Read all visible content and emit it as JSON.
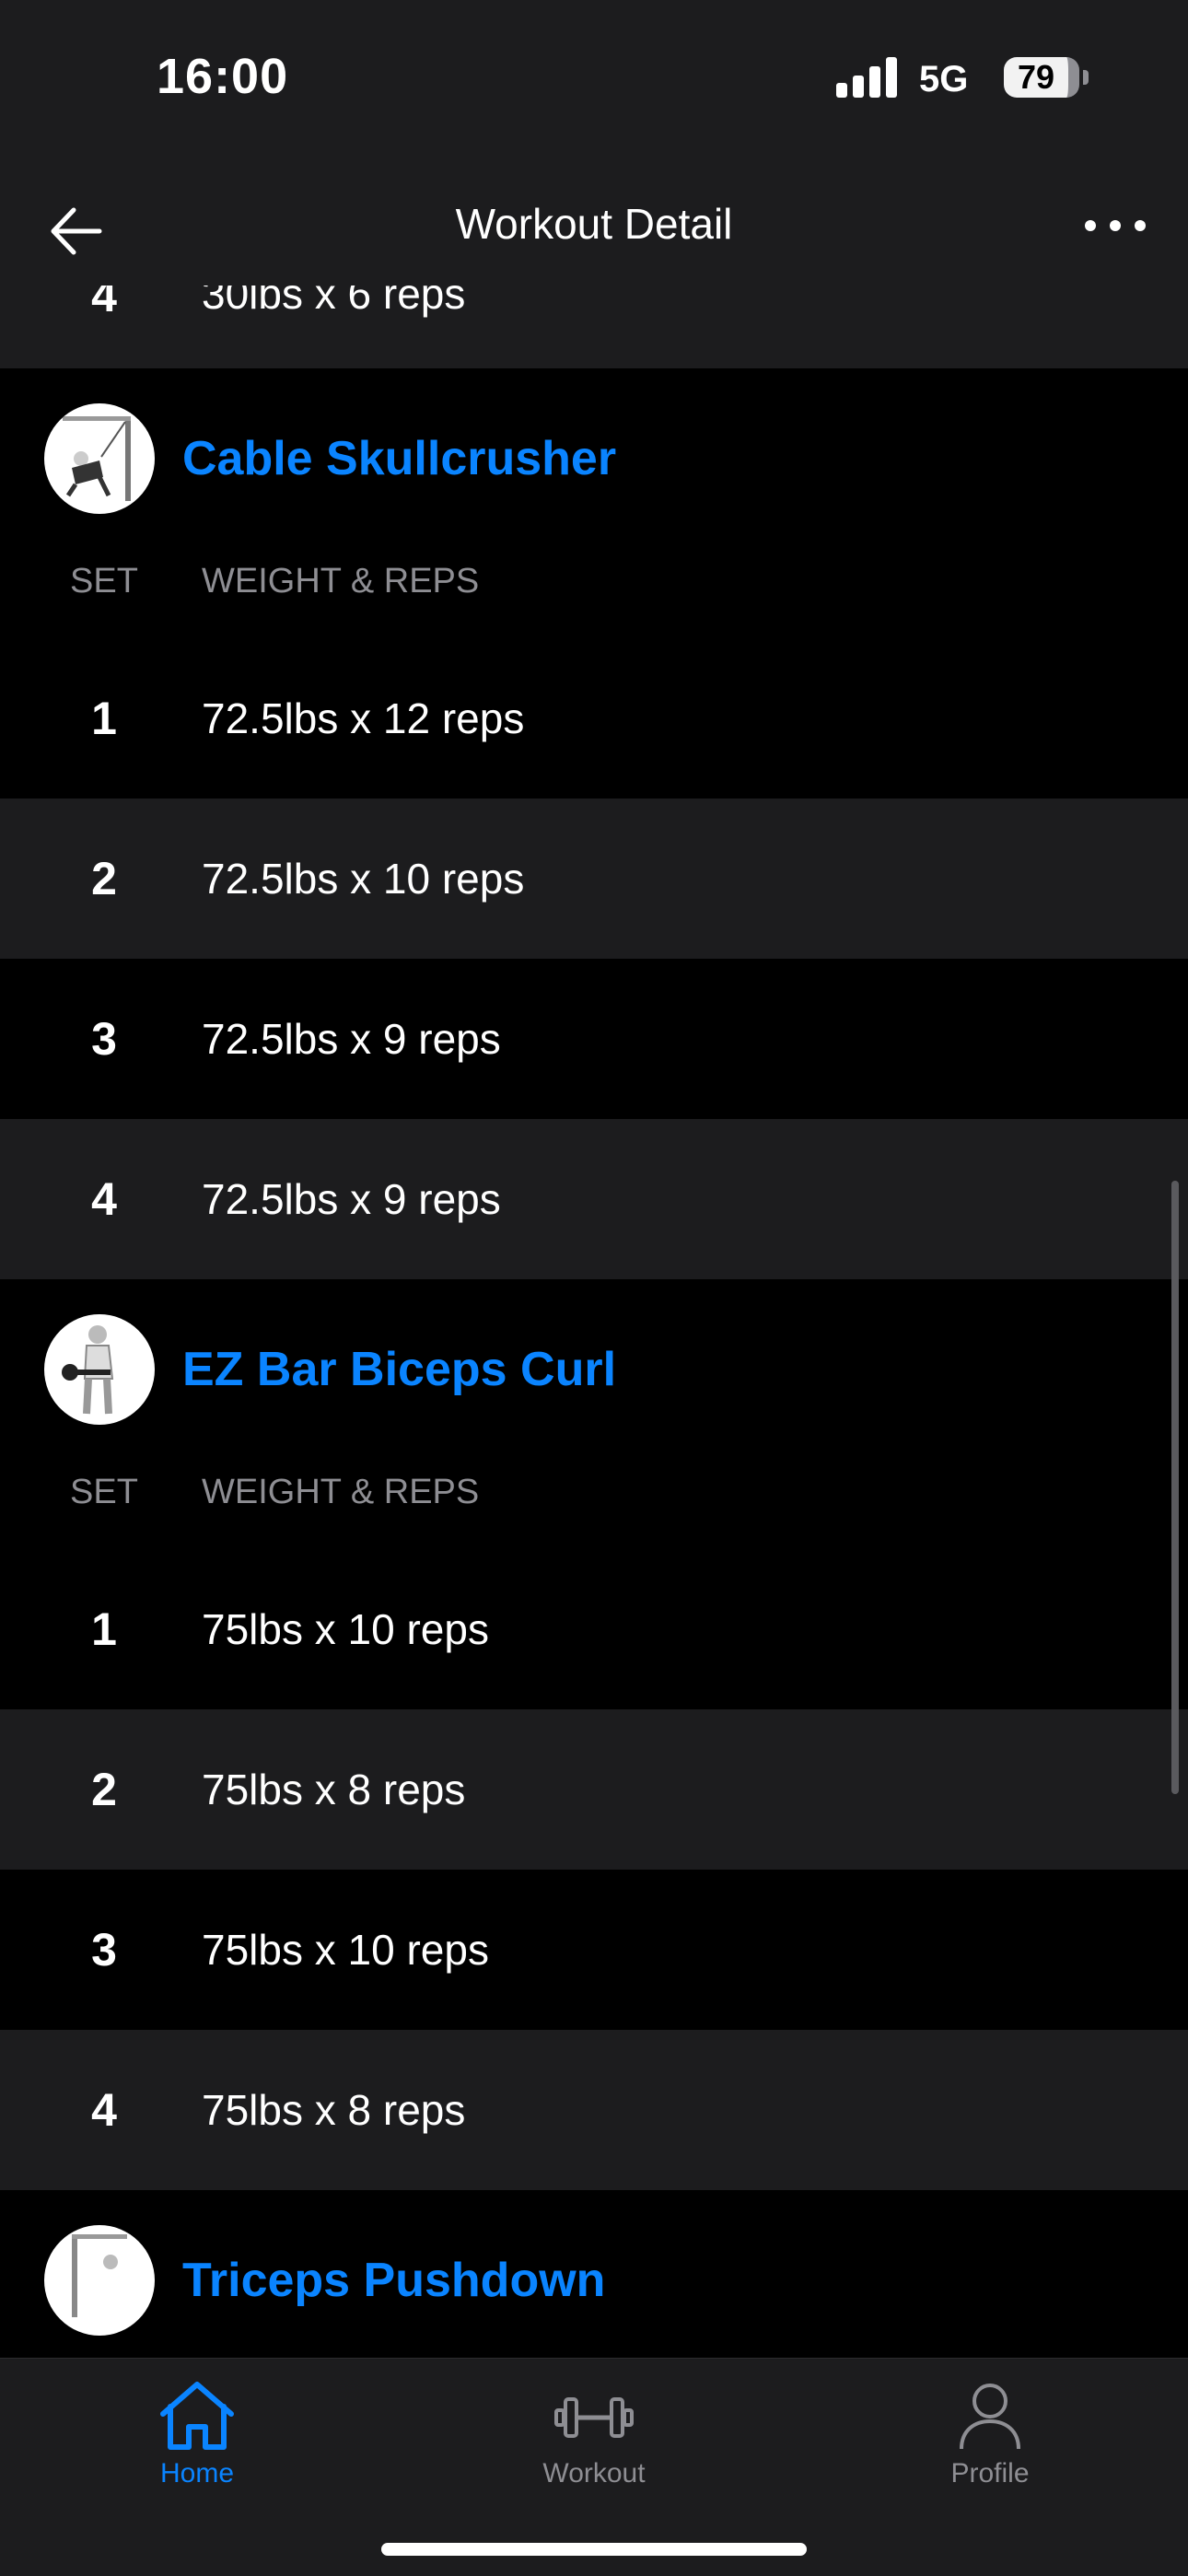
{
  "status_bar": {
    "time": "16:00",
    "network": "5G",
    "battery": "79"
  },
  "nav": {
    "title": "Workout Detail"
  },
  "prev_exercise": {
    "last_set": {
      "set": "4",
      "value": "30lbs x 6 reps"
    }
  },
  "exercises": [
    {
      "name": "Cable Skullcrusher",
      "col_set": "SET",
      "col_weight_reps": "WEIGHT & REPS",
      "sets": [
        {
          "set": "1",
          "value": "72.5lbs x 12 reps"
        },
        {
          "set": "2",
          "value": "72.5lbs x 10 reps"
        },
        {
          "set": "3",
          "value": "72.5lbs x 9 reps"
        },
        {
          "set": "4",
          "value": "72.5lbs x 9 reps"
        }
      ]
    },
    {
      "name": "EZ Bar Biceps Curl",
      "col_set": "SET",
      "col_weight_reps": "WEIGHT & REPS",
      "sets": [
        {
          "set": "1",
          "value": "75lbs x 10 reps"
        },
        {
          "set": "2",
          "value": "75lbs x 8 reps"
        },
        {
          "set": "3",
          "value": "75lbs x 10 reps"
        },
        {
          "set": "4",
          "value": "75lbs x 8 reps"
        }
      ]
    },
    {
      "name": "Triceps Pushdown"
    }
  ],
  "tabs": [
    {
      "label": "Home",
      "icon": "home-icon",
      "active": true
    },
    {
      "label": "Workout",
      "icon": "dumbbell-icon",
      "active": false
    },
    {
      "label": "Profile",
      "icon": "person-icon",
      "active": false
    }
  ],
  "colors": {
    "accent": "#0a84ff",
    "row_alt": "#1c1c1e",
    "muted": "#8e8e93"
  }
}
